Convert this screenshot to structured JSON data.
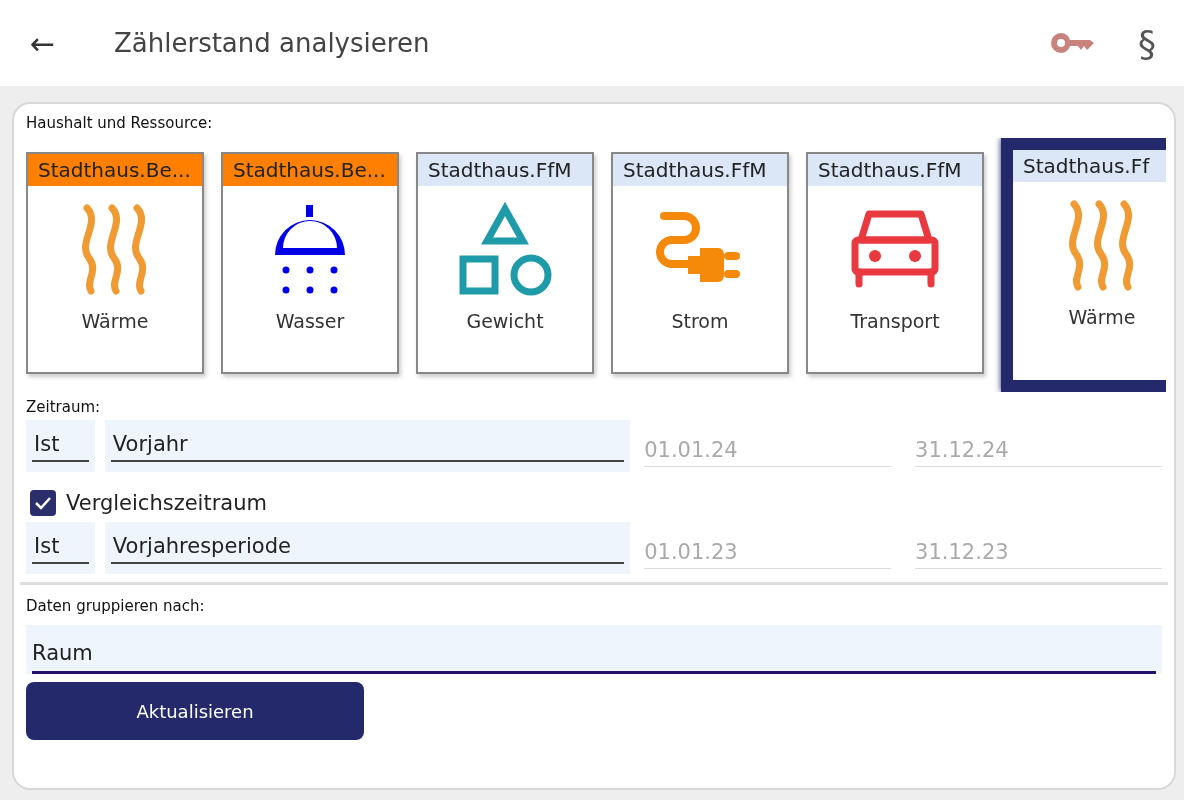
{
  "app_bar": {
    "back_icon": "←",
    "title": "Zählerstand analysieren",
    "paragraph_icon": "§"
  },
  "resources": {
    "label": "Haushalt und Ressource:",
    "tiles": [
      {
        "household": "Stadthaus.Be...",
        "color": "#ff8000",
        "kind": "heat",
        "name": "Wärme",
        "selected": false
      },
      {
        "household": "Stadthaus.Be...",
        "color": "#ff8000",
        "kind": "water",
        "name": "Wasser",
        "selected": false
      },
      {
        "household": "Stadthaus.FfM",
        "color": "#dbe7f7",
        "kind": "weight",
        "name": "Gewicht",
        "selected": false
      },
      {
        "household": "Stadthaus.FfM",
        "color": "#dbe7f7",
        "kind": "power",
        "name": "Strom",
        "selected": false
      },
      {
        "household": "Stadthaus.FfM",
        "color": "#dbe7f7",
        "kind": "transport",
        "name": "Transport",
        "selected": false
      },
      {
        "household": "Stadthaus.Ff",
        "color": "#dbe7f7",
        "kind": "heat",
        "name": "Wärme",
        "selected": true
      }
    ]
  },
  "period": {
    "label": "Zeitraum:",
    "type": "Ist",
    "range": "Vorjahr",
    "from": "01.01.24",
    "to": "31.12.24"
  },
  "comparison": {
    "label": "Vergleichszeitraum",
    "checked": true,
    "type": "Ist",
    "range": "Vorjahresperiode",
    "from": "01.01.23",
    "to": "31.12.23"
  },
  "grouping": {
    "label": "Daten gruppieren nach:",
    "value": "Raum"
  },
  "button": "Aktualisieren"
}
